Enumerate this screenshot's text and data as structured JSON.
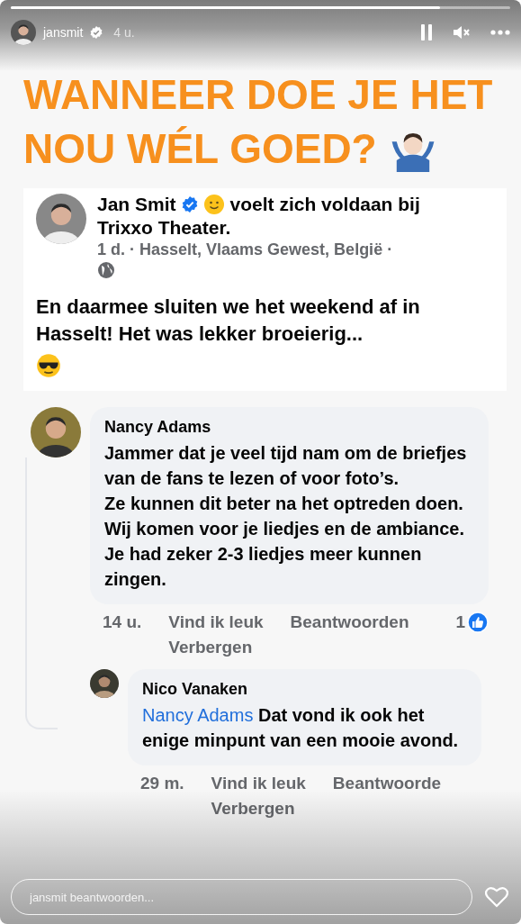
{
  "story": {
    "progress": {
      "level": 0.86
    },
    "username": "jansmit",
    "verified": true,
    "time": "4 u.",
    "paused": false,
    "muted": true
  },
  "headline": [
    "WANNEER DOE JE HET",
    "NOU WÉL GOED?"
  ],
  "post": {
    "author": "Jan Smit",
    "verified": true,
    "activity": "voelt zich voldaan bij",
    "place": "Trixxo Theater.",
    "meta": "1 d. · Hasselt, Vlaams Gewest, België ·",
    "text": "En daarmee sluiten we het weekend af in Hasselt! Het was lekker broeierig..."
  },
  "comments": [
    {
      "author": "Nancy Adams",
      "paragraphs": [
        "Jammer dat je veel tijd nam om de briefjes van de fans te lezen of voor foto’s.",
        "Ze kunnen dit beter na het optreden doen.",
        "Wij komen voor je liedjes en de ambiance.",
        "Je had zeker 2-3 liedjes meer kunnen zingen."
      ],
      "time": "14 u.",
      "like": "Vind ik leuk",
      "reply": "Beantwoorden",
      "hide": "Verbergen",
      "likes": "1",
      "replies": [
        {
          "author": "Nico Vanaken",
          "mention": "Nancy Adams",
          "paragraphs": [
            "Dat vond ik ook het enige minpunt van een mooie avond."
          ],
          "time": "29 m.",
          "like": "Vind ik leuk",
          "reply": "Beantwoorde",
          "hide": "Verbergen"
        }
      ]
    }
  ],
  "reply_field": {
    "placeholder": "jansmit beantwoorden..."
  }
}
